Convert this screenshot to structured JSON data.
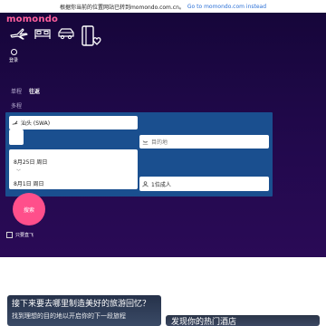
{
  "banner": {
    "message": "根据你当前的位置网站已转到momondo.com.cn。",
    "link": "Go to momondo.com instead"
  },
  "brand": {
    "logo": "momondo",
    "accent": "#ff4f8b"
  },
  "categories": [
    {
      "name": "flights",
      "icon": "plane-icon"
    },
    {
      "name": "hotels",
      "icon": "bed-icon"
    },
    {
      "name": "cars",
      "icon": "car-icon"
    },
    {
      "name": "packages",
      "icon": "suitcase-heart-icon"
    }
  ],
  "login": {
    "label": "登录",
    "icon": "user-icon"
  },
  "trip_tabs": {
    "oneway": "单程",
    "roundtrip": "往返",
    "multicity": "多程"
  },
  "search": {
    "origin": "汕头 (SWA)",
    "destination_placeholder": "目的地",
    "depart": "8月25日 周日",
    "return": "8月1日 周日",
    "travelers": "1位成人",
    "button": "搜索",
    "direct_only": "只要直飞"
  },
  "promos": {
    "card1_title": "接下来要去哪里制造美好的旅游回忆？",
    "card1_sub": "找到理想的目的地以开启你的下一段旅程",
    "card2_title": "发现你的热门酒店"
  }
}
